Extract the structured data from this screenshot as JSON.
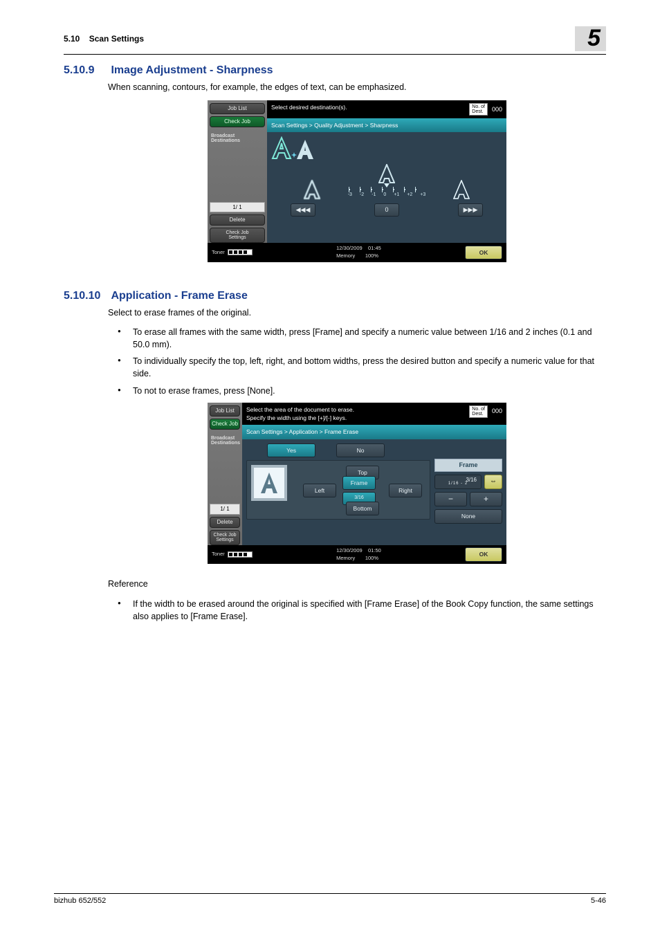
{
  "header": {
    "section_num": "5.10",
    "section_title": "Scan Settings",
    "chapter": "5"
  },
  "sec1": {
    "num": "5.10.9",
    "title": "Image Adjustment - Sharpness",
    "intro": "When scanning, contours, for example, the edges of text, can be emphasized."
  },
  "sec2": {
    "num": "5.10.10",
    "title": "Application - Frame Erase",
    "intro": "Select to erase frames of the original.",
    "bullets": [
      "To erase all frames with the same width, press [Frame] and specify a numeric value between 1/16 and 2 inches (0.1 and 50.0 mm).",
      "To individually specify the top, left, right, and bottom widths, press the desired button and specify a numeric value for that side.",
      "To not to erase frames, press [None]."
    ],
    "ref_label": "Reference",
    "ref_bullet": "If the width to be erased around the original is specified with [Frame Erase] of the Book Copy function, the same settings also applies to [Frame Erase]."
  },
  "scr_common": {
    "job_list": "Job List",
    "check_job": "Check Job",
    "broadcast": "Broadcast\nDestinations",
    "page": "1/  1",
    "delete": "Delete",
    "check_settings": "Check Job\nSettings",
    "toner": "Toner",
    "date": "12/30/2009",
    "memory_lbl": "Memory",
    "memory_pct": "100%",
    "ok": "OK",
    "nodest": "No. of\nDest.",
    "count": "000"
  },
  "scr1": {
    "top_msg": "Select desired destination(s).",
    "crumb": "Scan Settings > Quality Adjustment > Sharpness",
    "ticks": [
      "-3",
      "-2",
      "-1",
      "0",
      "+1",
      "+2",
      "+3"
    ],
    "btn_left": "◀◀◀",
    "btn_mid": "0",
    "btn_right": "▶▶▶",
    "time": "01:45"
  },
  "scr2": {
    "top_msg": "Select the area of the document to erase.\nSpecify the width using the [+]/[-] keys.",
    "crumb": "Scan Settings > Application > Frame Erase",
    "yes": "Yes",
    "no": "No",
    "top": "Top",
    "left_btn": "Left",
    "frame_btn": "Frame",
    "right_btn": "Right",
    "val_316": "3/16",
    "bottom": "Bottom",
    "panel_title": "Frame",
    "val_num_top": "3/16",
    "val_num_bot": "1/16    -    2",
    "arrows": "⇔",
    "minus": "−",
    "plus": "+",
    "none": "None",
    "time": "01:50"
  },
  "footer": {
    "left": "bizhub 652/552",
    "right": "5-46"
  }
}
